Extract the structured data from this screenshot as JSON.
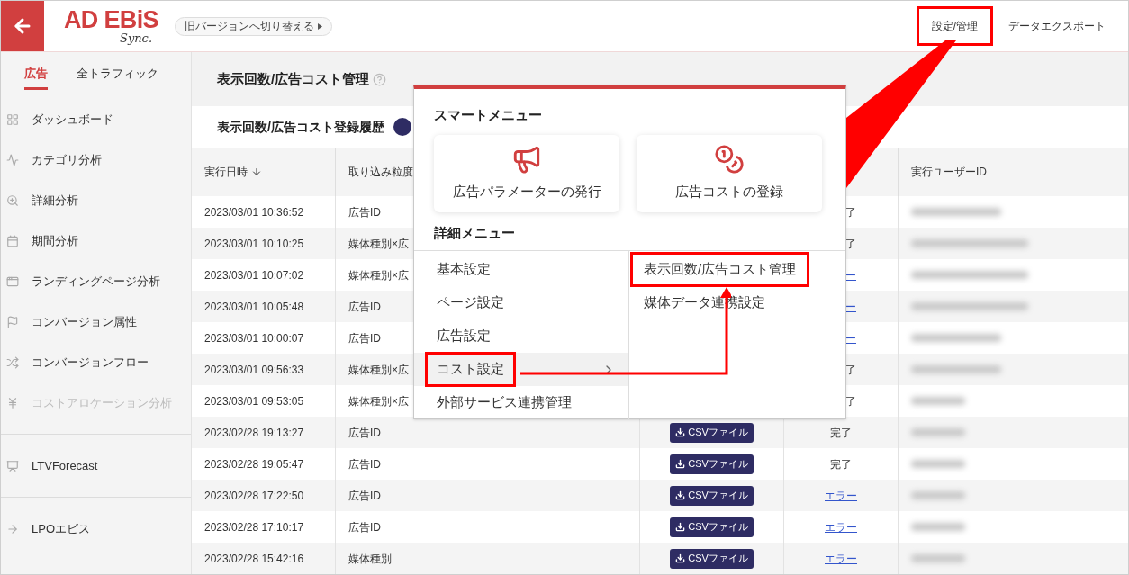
{
  "header": {
    "logo": {
      "text": "AD EBiS",
      "sub": "Sync."
    },
    "version_switch": "旧バージョンへ切り替える",
    "nav": [
      {
        "label": "設定/管理",
        "annotated": true
      },
      {
        "label": "データエクスポート",
        "annotated": false
      }
    ]
  },
  "sidebar": {
    "tabs": [
      {
        "label": "広告",
        "selected": true
      },
      {
        "label": "全トラフィック",
        "selected": false
      }
    ],
    "groups": [
      [
        {
          "label": "ダッシュボード",
          "disabled": false
        },
        {
          "label": "カテゴリ分析",
          "disabled": false
        },
        {
          "label": "詳細分析",
          "disabled": false
        },
        {
          "label": "期間分析",
          "disabled": false
        },
        {
          "label": "ランディングページ分析",
          "disabled": false
        },
        {
          "label": "コンバージョン属性",
          "disabled": false
        },
        {
          "label": "コンバージョンフロー",
          "disabled": false
        },
        {
          "label": "コストアロケーション分析",
          "disabled": true
        }
      ],
      [
        {
          "label": "LTVForecast",
          "disabled": false
        }
      ],
      [
        {
          "label": "LPOエビス",
          "disabled": false
        }
      ]
    ]
  },
  "page_title": "表示回数/広告コスト管理",
  "history": {
    "title": "表示回数/広告コスト登録履歴",
    "table": {
      "columns": [
        "実行日時",
        "取り込み粒度",
        "実行ユーザーID"
      ],
      "rows": [
        {
          "date": "2023/03/01 10:36:52",
          "granularity": "広告ID",
          "status": "了",
          "kind": "done"
        },
        {
          "date": "2023/03/01 10:10:25",
          "granularity": "媒体種別×広",
          "status": "了",
          "kind": "done"
        },
        {
          "date": "2023/03/01 10:07:02",
          "granularity": "媒体種別×広",
          "status": "ー",
          "kind": "error"
        },
        {
          "date": "2023/03/01 10:05:48",
          "granularity": "広告ID",
          "status": "ー",
          "kind": "error"
        },
        {
          "date": "2023/03/01 10:00:07",
          "granularity": "広告ID",
          "status": "ー",
          "kind": "error"
        },
        {
          "date": "2023/03/01 09:56:33",
          "granularity": "媒体種別×広",
          "status": "了",
          "kind": "done"
        },
        {
          "date": "2023/03/01 09:53:05",
          "granularity": "媒体種別×広",
          "status": "了",
          "kind": "done"
        },
        {
          "date": "2023/02/28 19:13:27",
          "granularity": "広告ID",
          "file": "CSVファイル",
          "status": "完了",
          "kind": "done"
        },
        {
          "date": "2023/02/28 19:05:47",
          "granularity": "広告ID",
          "file": "CSVファイル",
          "status": "完了",
          "kind": "done"
        },
        {
          "date": "2023/02/28 17:22:50",
          "granularity": "広告ID",
          "file": "CSVファイル",
          "status": "エラー",
          "kind": "error"
        },
        {
          "date": "2023/02/28 17:10:17",
          "granularity": "広告ID",
          "file": "CSVファイル",
          "status": "エラー",
          "kind": "error"
        },
        {
          "date": "2023/02/28 15:42:16",
          "granularity": "媒体種別",
          "file": "CSVファイル",
          "status": "エラー",
          "kind": "error"
        }
      ]
    }
  },
  "menu": {
    "smart_title": "スマートメニュー",
    "smart_items": [
      "広告パラメーターの発行",
      "広告コストの登録"
    ],
    "detail_title": "詳細メニュー",
    "detail_items": [
      {
        "label": "基本設定",
        "hovered": false,
        "has_submenu": false,
        "annotated": false
      },
      {
        "label": "ページ設定",
        "hovered": false,
        "has_submenu": false,
        "annotated": false
      },
      {
        "label": "広告設定",
        "hovered": false,
        "has_submenu": false,
        "annotated": false
      },
      {
        "label": "コスト設定",
        "hovered": true,
        "has_submenu": true,
        "annotated": true
      },
      {
        "label": "外部サービス連携管理",
        "hovered": false,
        "has_submenu": false,
        "annotated": false
      }
    ],
    "submenu": [
      {
        "label": "表示回数/広告コスト管理",
        "annotated": true
      },
      {
        "label": "媒体データ連携設定",
        "annotated": false
      }
    ]
  }
}
